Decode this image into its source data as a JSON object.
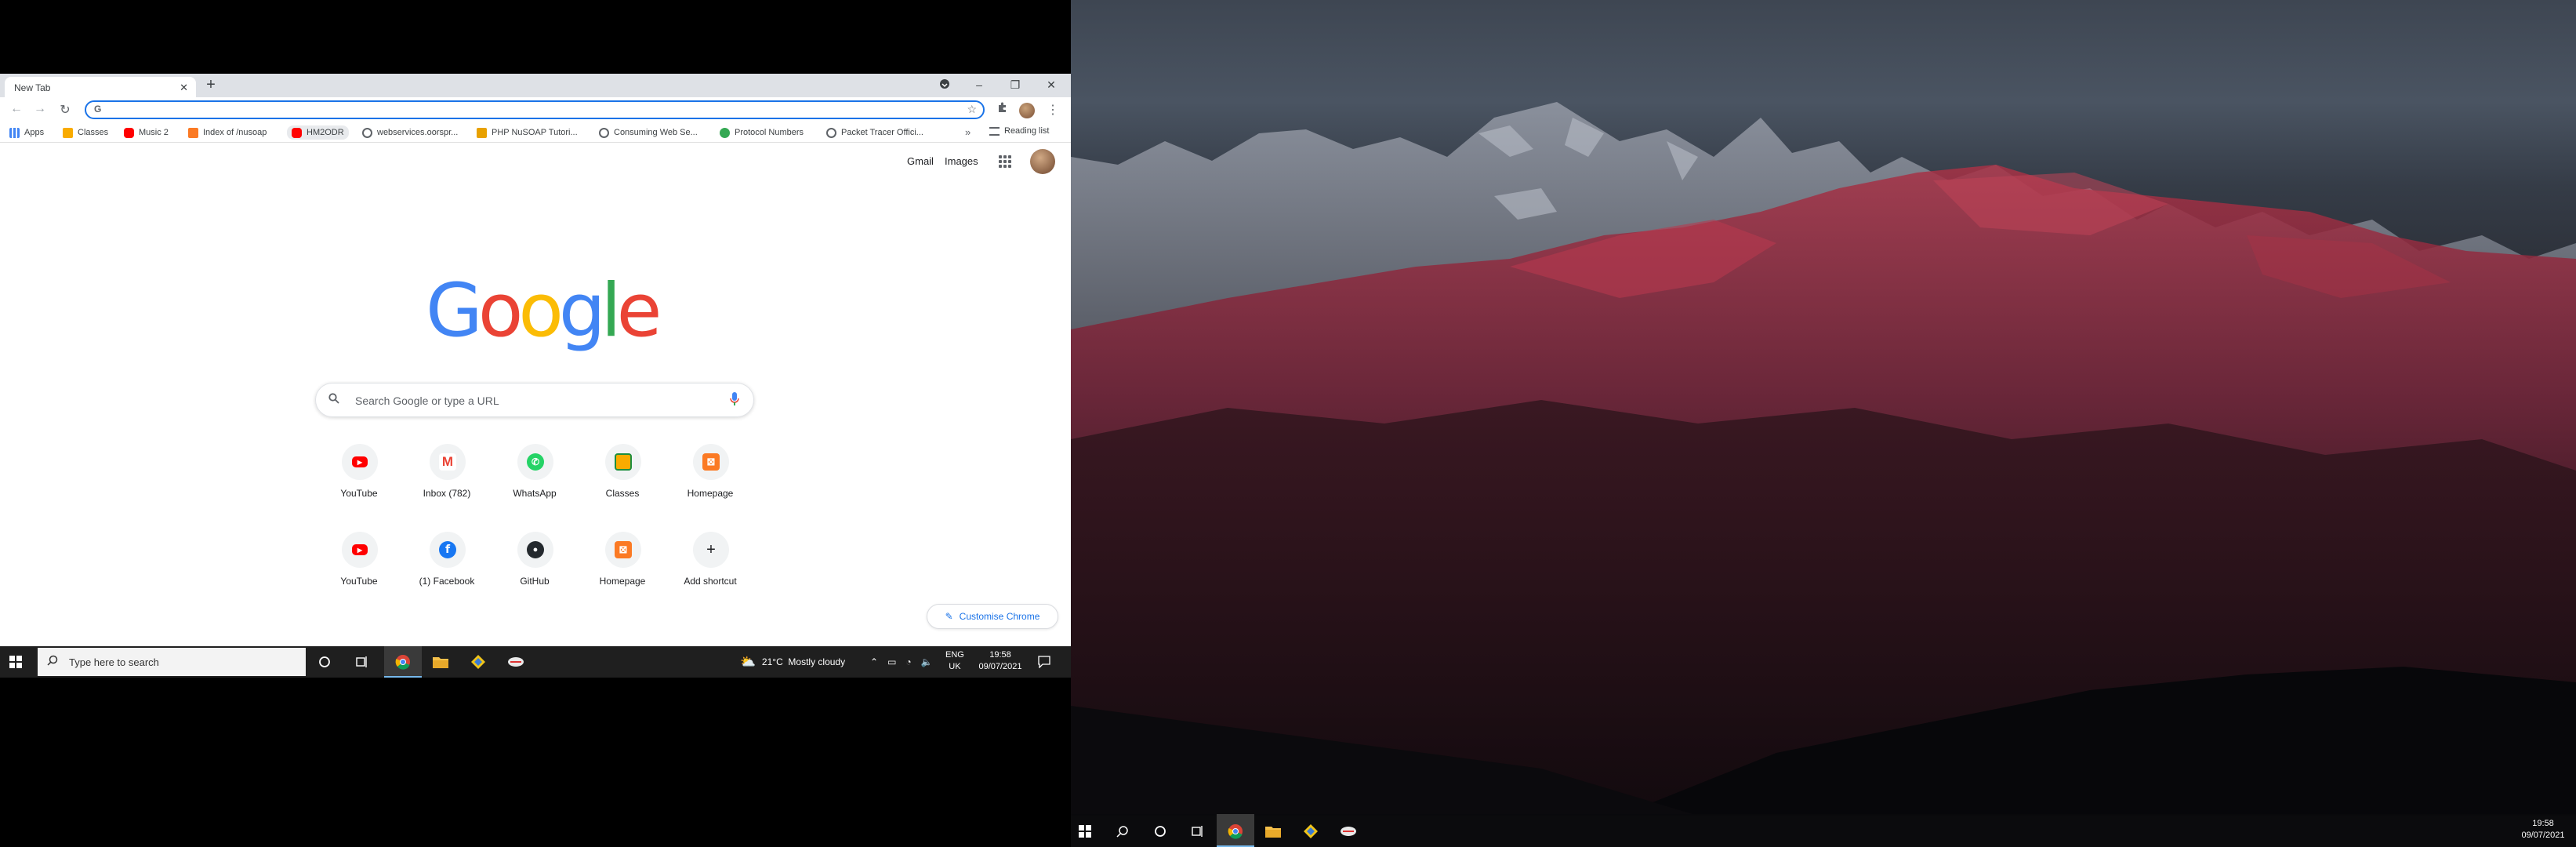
{
  "browser": {
    "tab_title": "New Tab",
    "address_value": "G",
    "bookmarks": [
      {
        "label": "Apps",
        "icon": "apps-grid-icon",
        "color": "#4285f4"
      },
      {
        "label": "Classes",
        "icon": "classroom-icon",
        "color": "#f9ab00"
      },
      {
        "label": "Music 2",
        "icon": "youtube-icon",
        "color": "#ff0000"
      },
      {
        "label": "Index of /nusoap",
        "icon": "xampp-icon",
        "color": "#fb7a24"
      },
      {
        "label": "HM2ODR",
        "icon": "youtube-icon",
        "color": "#ff0000"
      },
      {
        "label": "webservices.oorspr...",
        "icon": "globe-icon",
        "color": "#5f6368"
      },
      {
        "label": "PHP NuSOAP Tutori...",
        "icon": "bookmark-icon",
        "color": "#e8a100"
      },
      {
        "label": "Consuming Web Se...",
        "icon": "globe-icon",
        "color": "#5f6368"
      },
      {
        "label": "Protocol Numbers",
        "icon": "globe-icon",
        "color": "#34a853"
      },
      {
        "label": "Packet Tracer Offici...",
        "icon": "globe-icon",
        "color": "#5f6368"
      }
    ],
    "more_bookmarks": "»",
    "reading_list": "Reading list"
  },
  "google": {
    "gmail": "Gmail",
    "images": "Images",
    "search_placeholder": "Search Google or type a URL",
    "shortcuts": [
      {
        "label": "YouTube",
        "icon": "youtube-icon",
        "color": "#ff0000"
      },
      {
        "label": "Inbox (782)",
        "icon": "gmail-icon",
        "color": "#ea4335"
      },
      {
        "label": "WhatsApp",
        "icon": "whatsapp-icon",
        "color": "#25d366"
      },
      {
        "label": "Classes",
        "icon": "classroom-icon",
        "color": "#f9ab00"
      },
      {
        "label": "Homepage",
        "icon": "xampp-icon",
        "color": "#fb7a24"
      },
      {
        "label": "YouTube",
        "icon": "youtube-icon",
        "color": "#ff0000"
      },
      {
        "label": "(1) Facebook",
        "icon": "facebook-icon",
        "color": "#1877f2"
      },
      {
        "label": "GitHub",
        "icon": "github-icon",
        "color": "#24292e"
      },
      {
        "label": "Homepage",
        "icon": "xampp-icon",
        "color": "#fb7a24"
      },
      {
        "label": "Add shortcut",
        "icon": "plus-icon",
        "color": "#202124"
      }
    ],
    "customise": "Customise Chrome"
  },
  "taskbar_left": {
    "search_placeholder": "Type here to search",
    "weather": "21°C  Mostly cloudy",
    "lang_top": "ENG",
    "lang_bottom": "UK",
    "time": "19:58",
    "date": "09/07/2021"
  },
  "taskbar_right": {
    "time": "19:58",
    "date": "09/07/2021"
  }
}
